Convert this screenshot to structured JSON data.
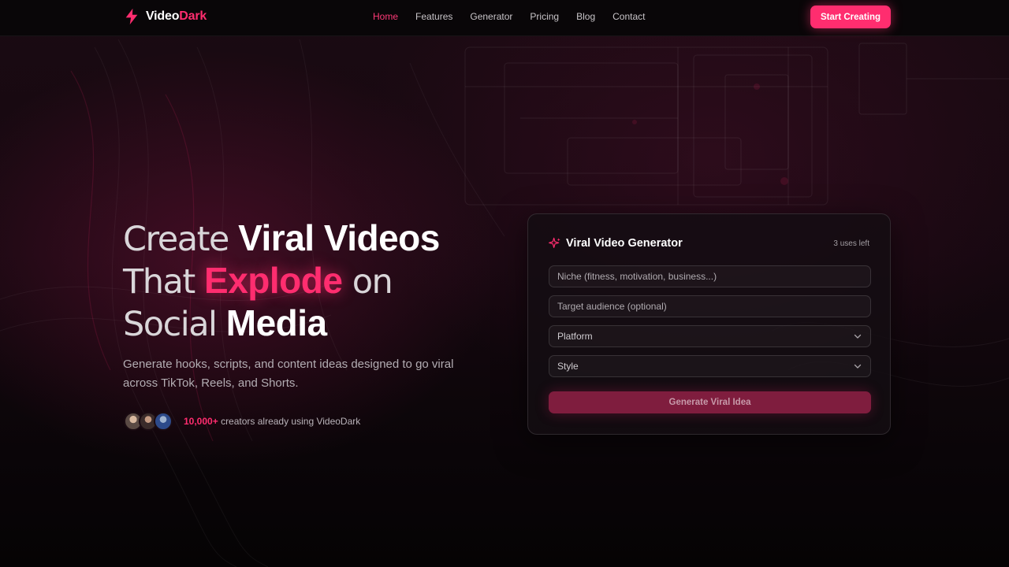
{
  "nav": {
    "logo_left": "Video",
    "logo_right": "Dark",
    "links": [
      "Home",
      "Features",
      "Generator",
      "Pricing",
      "Blog",
      "Contact"
    ],
    "active_link": "Home",
    "cta_label": "Start Creating"
  },
  "hero": {
    "line1_light": "Create",
    "line1_bold": "Viral Videos",
    "line2_light": "That",
    "line2_pink": "Explode",
    "line2_light_end": "on",
    "line3_light": "Social",
    "line3_bold": "Media",
    "subtitle": "Generate hooks, scripts, and content ideas designed to go viral across TikTok, Reels, and Shorts.",
    "social_count": "10,000+",
    "social_text": "creators already using VideoDark"
  },
  "generator": {
    "title": "Viral Video Generator",
    "uses_left": "3 uses left",
    "niche_placeholder": "Niche (fitness, motivation, business...)",
    "audience_placeholder": "Target audience (optional)",
    "platform_label": "Platform",
    "style_label": "Style",
    "button_label": "Generate Viral Idea"
  },
  "colors": {
    "accent": "#ff2d6f",
    "background": "#0a0508",
    "button_disabled": "#7f1d3e"
  },
  "icons": {
    "logo": "lightning-bolt-icon",
    "generator": "sparkle-icon",
    "select": "chevron-down-icon"
  }
}
